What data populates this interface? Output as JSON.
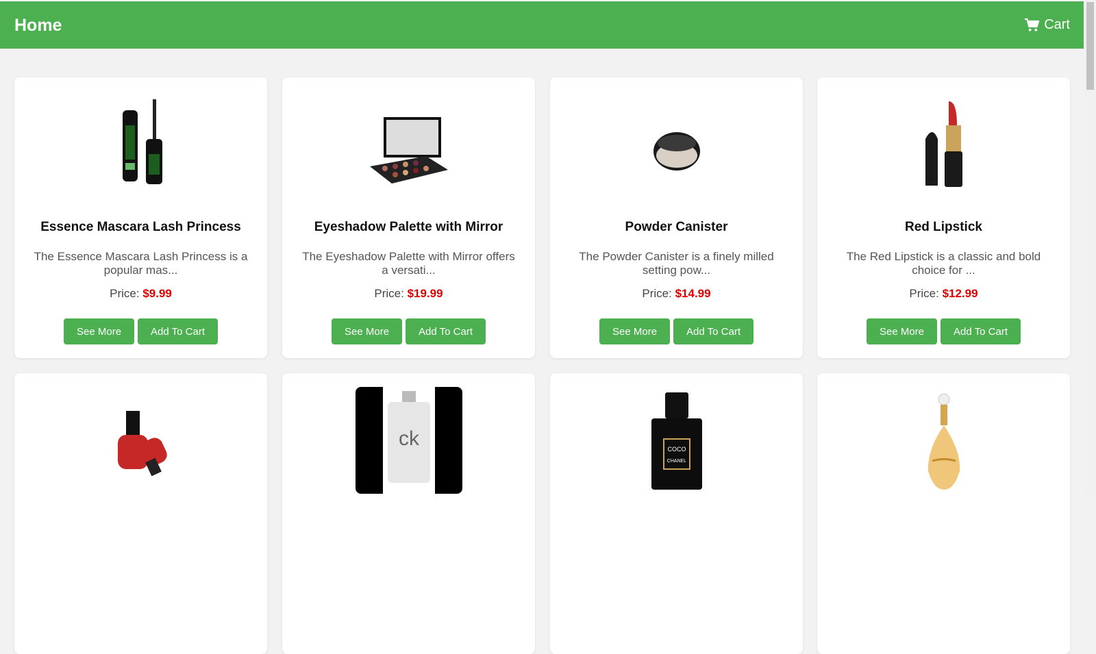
{
  "header": {
    "home_label": "Home",
    "cart_label": "Cart",
    "color": "#4caf50"
  },
  "price_prefix": "Price: ",
  "buttons": {
    "see_more": "See More",
    "add_to_cart": "Add To Cart"
  },
  "products": [
    {
      "name": "Essence Mascara Lash Princess",
      "description": "The Essence Mascara Lash Princess is a popular mas...",
      "price": "$9.99",
      "image": "mascara-image"
    },
    {
      "name": "Eyeshadow Palette with Mirror",
      "description": "The Eyeshadow Palette with Mirror offers a versati...",
      "price": "$19.99",
      "image": "eyeshadow-palette-image"
    },
    {
      "name": "Powder Canister",
      "description": "The Powder Canister is a finely milled setting pow...",
      "price": "$14.99",
      "image": "powder-canister-image"
    },
    {
      "name": "Red Lipstick",
      "description": "The Red Lipstick is a classic and bold choice for ...",
      "price": "$12.99",
      "image": "red-lipstick-image"
    },
    {
      "image": "nail-polish-image"
    },
    {
      "image": "ck-perfume-image",
      "label": "ck"
    },
    {
      "image": "chanel-perfume-image",
      "label_lines": [
        "COCO",
        "CHANEL"
      ]
    },
    {
      "image": "dior-perfume-image"
    }
  ]
}
